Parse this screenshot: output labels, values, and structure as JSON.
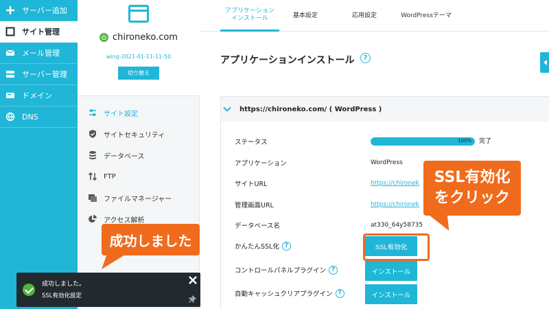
{
  "sidebar": {
    "items": [
      {
        "label": "サーバー追加",
        "icon": "plus-icon"
      },
      {
        "label": "サイト管理",
        "icon": "window-icon"
      },
      {
        "label": "メール管理",
        "icon": "mail-icon"
      },
      {
        "label": "サーバー管理",
        "icon": "server-icon"
      },
      {
        "label": "ドメイン",
        "icon": "domain-icon"
      },
      {
        "label": "DNS",
        "icon": "globe-icon"
      }
    ]
  },
  "site_panel": {
    "domain": "chironeko.com",
    "server": "wing-2021-01-11-11-50",
    "switch_label": "切り替え",
    "menu": [
      {
        "label": "サイト設定",
        "icon": "sliders-icon"
      },
      {
        "label": "サイトセキュリティ",
        "icon": "shield-icon"
      },
      {
        "label": "データベース",
        "icon": "database-icon"
      },
      {
        "label": "FTP",
        "icon": "transfer-icon"
      },
      {
        "label": "ファイルマネージャー",
        "icon": "folder-icon"
      },
      {
        "label": "アクセス解析",
        "icon": "pie-chart-icon"
      }
    ]
  },
  "tabs": [
    {
      "line1": "アプリケーション",
      "line2": "インストール"
    },
    {
      "line1": "基本設定",
      "line2": ""
    },
    {
      "line1": "応用設定",
      "line2": ""
    },
    {
      "line1": "WordPressテーマ",
      "line2": ""
    }
  ],
  "main": {
    "title": "アプリケーションインストール",
    "help": "?",
    "app_header": "https://chironeko.com/ ( WordPress )",
    "rows": {
      "status_label": "ステータス",
      "status_progress": 100,
      "status_progress_text": "100%",
      "status_value": "完了",
      "application_label": "アプリケーション",
      "application_value": "WordPress",
      "site_url_label": "サイトURL",
      "site_url_value": "https://chironek",
      "admin_url_label": "管理画面URL",
      "admin_url_value": "https://chironek",
      "db_label": "データベース名",
      "db_value": "at330_64y58735",
      "ssl_label": "かんたんSSL化",
      "ssl_button": "SSL有効化",
      "cp_plugin_label": "コントロールパネルプラグイン",
      "cp_plugin_button": "インストール",
      "cache_plugin_label": "自動キャッシュクリアプラグイン",
      "cache_plugin_button": "インストール"
    }
  },
  "annotations": {
    "ssl_line1": "SSL有効化",
    "ssl_line2": "をクリック",
    "success": "成功しました",
    "color": "#f06b1c"
  },
  "toast": {
    "title": "成功しました。",
    "message": "SSL有効化設定"
  },
  "colors": {
    "accent": "#1fb6d8",
    "success": "#52b340",
    "toast_bg": "#222a30"
  }
}
